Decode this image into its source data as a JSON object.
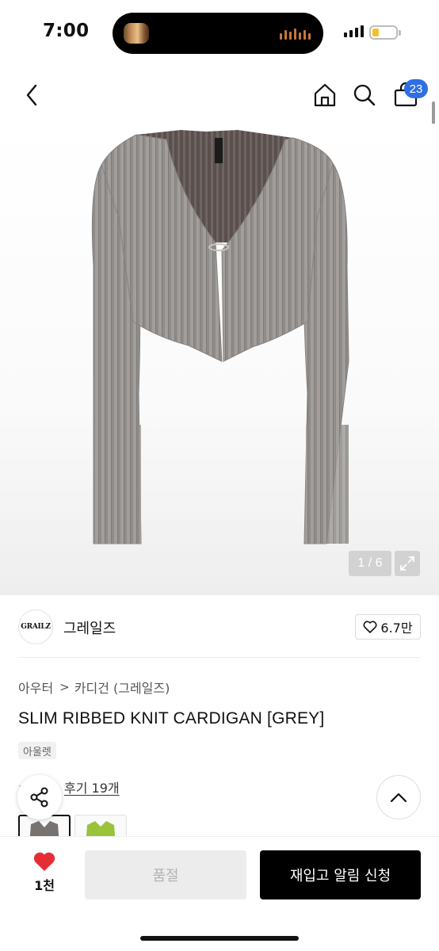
{
  "status_bar": {
    "time": "7:00"
  },
  "nav": {
    "cart_count": "23"
  },
  "product_image": {
    "counter": "1 / 6",
    "current": 1,
    "total": 6
  },
  "brand": {
    "logo_text": "GRAILZ",
    "name": "그레일즈",
    "like_count": "6.7만"
  },
  "breadcrumb": {
    "category": "아우터",
    "subcategory": "카디건 (그레일즈)"
  },
  "product": {
    "title": "SLIM RIBBED KNIT CARDIGAN [GREY]",
    "tag": "아울렛",
    "review_label": "후기 19개"
  },
  "colors": {
    "accent_blue": "#2f6fe6",
    "heart_red": "#e62d35",
    "primary_black": "#000000",
    "disabled_grey": "#ececec"
  },
  "bottom_bar": {
    "wish_count": "1천",
    "soldout_label": "품절",
    "restock_label": "재입고 알림 신청"
  }
}
